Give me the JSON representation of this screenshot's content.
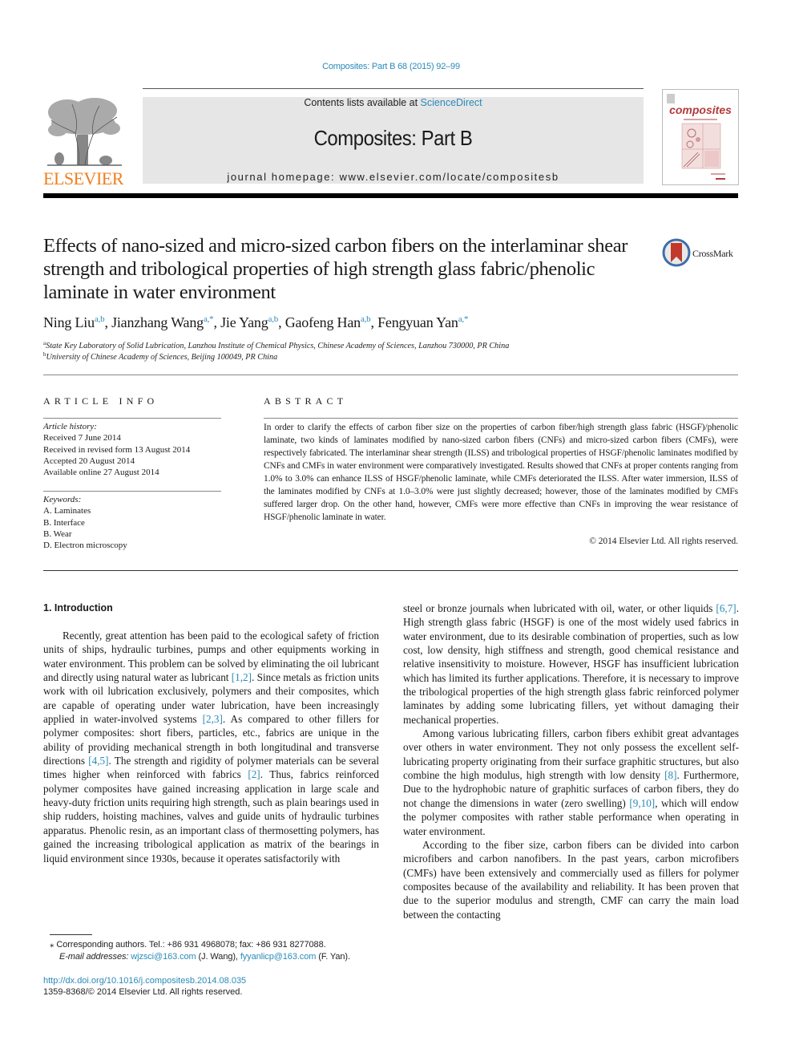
{
  "header": {
    "journal_ref": "Composites: Part B 68 (2015) 92–99",
    "contents_prefix": "Contents lists available at ",
    "contents_link": "ScienceDirect",
    "journal_title": "Composites: Part B",
    "homepage_prefix": "journal homepage: ",
    "homepage_url": "www.elsevier.com/locate/compositesb",
    "publisher": "ELSEVIER",
    "cover_title": "composites",
    "crossmark_label": "CrossMark"
  },
  "colors": {
    "link": "#2a8ab8",
    "elsevier_orange": "#f07f1f",
    "masthead_bg": "#e6e6e6",
    "cover_red": "#b23a3a"
  },
  "article": {
    "title": "Effects of nano-sized and micro-sized carbon fibers on the interlaminar shear strength and tribological properties of high strength glass fabric/phenolic laminate in water environment",
    "authors": [
      {
        "name": "Ning Liu",
        "aff": "a,b"
      },
      {
        "name": "Jianzhang Wang",
        "aff": "a,*"
      },
      {
        "name": "Jie Yang",
        "aff": "a,b"
      },
      {
        "name": "Gaofeng Han",
        "aff": "a,b"
      },
      {
        "name": "Fengyuan Yan",
        "aff": "a,*"
      }
    ],
    "affiliations": [
      {
        "key": "a",
        "text": "State Key Laboratory of Solid Lubrication, Lanzhou Institute of Chemical Physics, Chinese Academy of Sciences, Lanzhou 730000, PR China"
      },
      {
        "key": "b",
        "text": "University of Chinese Academy of Sciences, Beijing 100049, PR China"
      }
    ]
  },
  "article_info": {
    "heading": "ARTICLE INFO",
    "history_label": "Article history:",
    "history": [
      "Received 7 June 2014",
      "Received in revised form 13 August 2014",
      "Accepted 20 August 2014",
      "Available online 27 August 2014"
    ],
    "keywords_label": "Keywords:",
    "keywords": [
      "A. Laminates",
      "B. Interface",
      "B. Wear",
      "D. Electron microscopy"
    ]
  },
  "abstract": {
    "heading": "ABSTRACT",
    "text": "In order to clarify the effects of carbon fiber size on the properties of carbon fiber/high strength glass fabric (HSGF)/phenolic laminate, two kinds of laminates modified by nano-sized carbon fibers (CNFs) and micro-sized carbon fibers (CMFs), were respectively fabricated. The interlaminar shear strength (ILSS) and tribological properties of HSGF/phenolic laminates modified by CNFs and CMFs in water environment were comparatively investigated. Results showed that CNFs at proper contents ranging from 1.0% to 3.0% can enhance ILSS of HSGF/phenolic laminate, while CMFs deteriorated the ILSS. After water immersion, ILSS of the laminates modified by CNFs at 1.0–3.0% were just slightly decreased; however, those of the laminates modified by CMFs suffered larger drop. On the other hand, however, CMFs were more effective than CNFs in improving the wear resistance of HSGF/phenolic laminate in water.",
    "copyright": "© 2014 Elsevier Ltd. All rights reserved."
  },
  "body": {
    "section_heading": "1. Introduction",
    "left_paragraphs": [
      [
        {
          "t": "Recently, great attention has been paid to the ecological safety of friction units of ships, hydraulic turbines, pumps and other equipments working in water environment. This problem can be solved by eliminating the oil lubricant and directly using natural water as lubricant "
        },
        {
          "c": "[1,2]"
        },
        {
          "t": ". Since metals as friction units work with oil lubrication exclusively, polymers and their composites, which are capable of operating under water lubrication, have been increasingly applied in water-involved systems "
        },
        {
          "c": "[2,3]"
        },
        {
          "t": ". As compared to other fillers for polymer composites: short fibers, particles, etc., fabrics are unique in the ability of providing mechanical strength in both longitudinal and transverse directions "
        },
        {
          "c": "[4,5]"
        },
        {
          "t": ". The strength and rigidity of polymer materials can be several times higher when reinforced with fabrics "
        },
        {
          "c": "[2]"
        },
        {
          "t": ". Thus, fabrics reinforced polymer composites have gained increasing application in large scale and heavy-duty friction units requiring high strength, such as plain bearings used in ship rudders, hoisting machines, valves and guide units of hydraulic turbines apparatus. Phenolic resin, as an important class of thermosetting polymers, has gained the increasing tribological application as matrix of the bearings in liquid environment since 1930s, because it operates satisfactorily with"
        }
      ]
    ],
    "right_paragraphs": [
      [
        {
          "t": "steel or bronze journals when lubricated with oil, water, or other liquids "
        },
        {
          "c": "[6,7]"
        },
        {
          "t": ". High strength glass fabric (HSGF) is one of the most widely used fabrics in water environment, due to its desirable combination of properties, such as low cost, low density, high stiffness and strength, good chemical resistance and relative insensitivity to moisture. However, HSGF has insufficient lubrication which has limited its further applications. Therefore, it is necessary to improve the tribological properties of the high strength glass fabric reinforced polymer laminates by adding some lubricating fillers, yet without damaging their mechanical properties."
        }
      ],
      [
        {
          "t": "Among various lubricating fillers, carbon fibers exhibit great advantages over others in water environment. They not only possess the excellent self-lubricating property originating from their surface graphitic structures, but also combine the high modulus, high strength with low density "
        },
        {
          "c": "[8]"
        },
        {
          "t": ". Furthermore, Due to the hydrophobic nature of graphitic surfaces of carbon fibers, they do not change the dimensions in water (zero swelling) "
        },
        {
          "c": "[9,10]"
        },
        {
          "t": ", which will endow the polymer composites with rather stable performance when operating in water environment."
        }
      ],
      [
        {
          "t": "According to the fiber size, carbon fibers can be divided into carbon microfibers and carbon nanofibers. In the past years, carbon microfibers (CMFs) have been extensively and commercially used as fillers for polymer composites because of the availability and reliability. It has been proven that due to the superior modulus and strength, CMF can carry the main load between the contacting"
        }
      ]
    ]
  },
  "footnotes": {
    "corresponding": "⁎ Corresponding authors. Tel.: +86 931 4968078; fax: +86 931 8277088.",
    "email_label": "E-mail addresses: ",
    "email_1": "wjzsci@163.com",
    "email_1_who": " (J. Wang), ",
    "email_2": "fyyanlicp@163.com",
    "email_2_who": " (F. Yan).",
    "doi": "http://dx.doi.org/10.1016/j.compositesb.2014.08.035",
    "issn": "1359-8368/© 2014 Elsevier Ltd. All rights reserved."
  }
}
